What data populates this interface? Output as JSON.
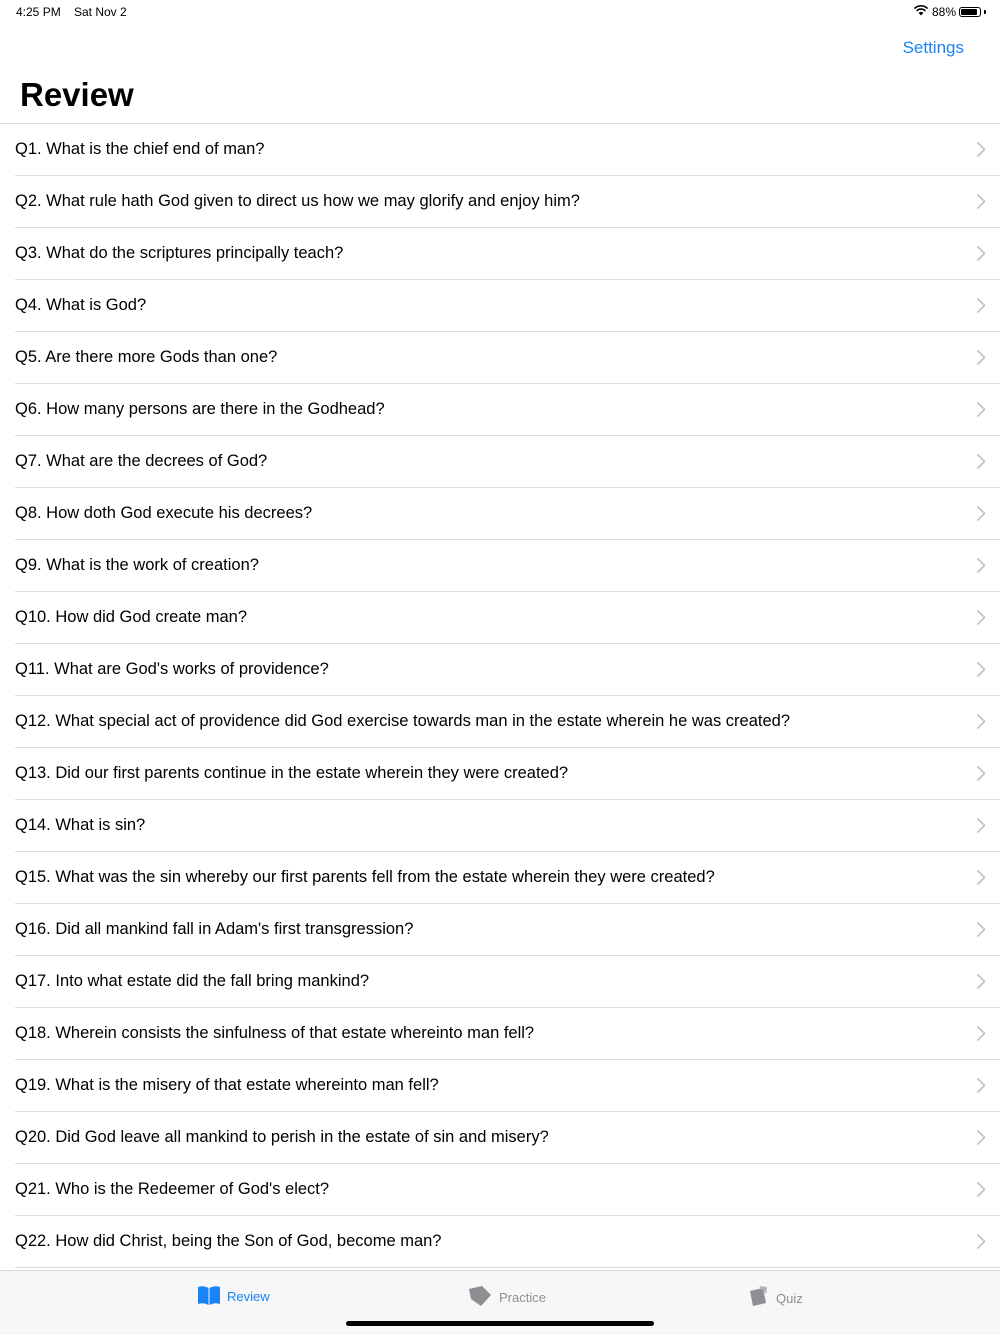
{
  "status_bar": {
    "time": "4:25 PM",
    "date": "Sat Nov 2",
    "battery_percent": "88%",
    "battery_level": 0.88
  },
  "nav": {
    "settings_label": "Settings",
    "title": "Review"
  },
  "questions": [
    "Q1. What is the chief end of man?",
    "Q2. What rule hath God given to direct us how we may glorify and enjoy him?",
    "Q3. What do the scriptures principally teach?",
    "Q4. What is God?",
    "Q5. Are there more Gods than one?",
    "Q6. How many persons are there in the Godhead?",
    "Q7. What are the decrees of God?",
    "Q8. How doth God execute his decrees?",
    "Q9. What is the work of creation?",
    "Q10. How did God create man?",
    "Q11. What are God's works of providence?",
    "Q12. What special act of providence did God exercise towards man in the estate wherein he was created?",
    "Q13. Did our first parents continue in the estate wherein they were created?",
    "Q14. What is sin?",
    "Q15. What was the sin whereby our first parents fell from the estate wherein they were created?",
    "Q16. Did all mankind fall in Adam's first transgression?",
    "Q17. Into what estate did the fall bring mankind?",
    "Q18. Wherein consists the sinfulness of that estate whereinto man fell?",
    "Q19. What is the misery of that estate whereinto man fell?",
    "Q20. Did God leave all mankind to perish in the estate of sin and misery?",
    "Q21. Who is the Redeemer of God's elect?",
    "Q22. How did Christ, being the Son of God, become man?"
  ],
  "tabs": [
    {
      "label": "Review",
      "icon": "book-icon",
      "selected": true
    },
    {
      "label": "Practice",
      "icon": "tag-icon",
      "selected": false
    },
    {
      "label": "Quiz",
      "icon": "cards-icon",
      "selected": false
    }
  ],
  "colors": {
    "accent": "#1a84f6",
    "inactive": "#8e8e93",
    "separator": "#dcdcdc"
  }
}
